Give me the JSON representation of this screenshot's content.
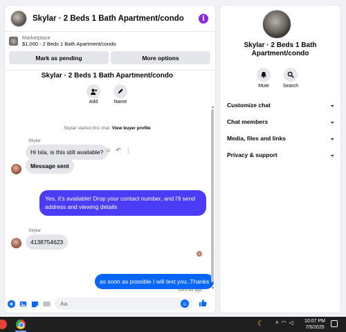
{
  "chat": {
    "title": "Skylar · 2 Beds 1 Bath Apartment/condo",
    "info_icon": "i",
    "marketplace": {
      "label": "Marketplace",
      "listing": "$1,000 - 2 Beds 1 Bath Apartment/condo",
      "btn_pending": "Mark as pending",
      "btn_more": "More options"
    },
    "convo_title": "Skylar · 2 Beds 1 Bath Apartment/condo",
    "actions": {
      "add": "Add",
      "name": "Name"
    },
    "system_note": "Skylar started this chat.",
    "system_link": "View buyer profile",
    "messages": {
      "sender1": "Skylar",
      "msg1": "Hi Isla, is this still available?",
      "msg2": "Message sent",
      "msg3": "Yes, it's available! Drop your contact number, and I'll send address and viewing details",
      "sender2": "Skylar",
      "msg4": "4138754623",
      "msg5": "as soon as possible I will text you..Thanks",
      "sent_note": "Sent 4d ago"
    },
    "composer_placeholder": "Aa"
  },
  "right_panel": {
    "title": "Skylar · 2 Beds 1 Bath Apartment/condo",
    "mute": "Mute",
    "search": "Search",
    "menu": [
      "Customize chat",
      "Chat members",
      "Media, files and links",
      "Privacy & support"
    ]
  },
  "taskbar": {
    "time": "10:07 PM",
    "date": "7/5/2025"
  },
  "icons": {
    "info": "info-icon",
    "add_person": "add-person-icon",
    "edit": "pencil-icon",
    "mute": "bell-icon",
    "search": "search-icon",
    "chevron": "chevron-down-icon"
  },
  "colors": {
    "outgoing_bubble": "#4a3cf7",
    "outgoing_bubble_alt": "#0866ff",
    "info_purple": "#8a2be2",
    "incoming_bubble": "#e4e6eb"
  }
}
